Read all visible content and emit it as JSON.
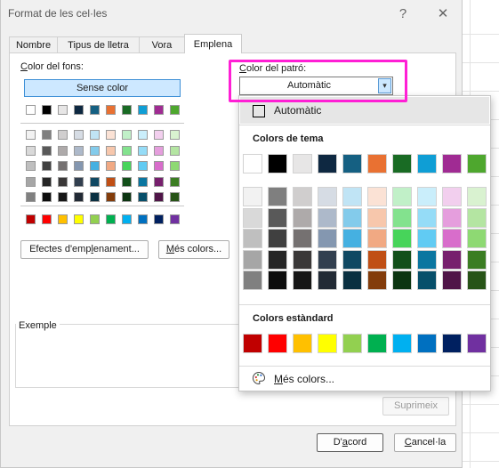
{
  "dialog": {
    "title": "Format de les cel·les",
    "help": "?",
    "close": "✕"
  },
  "tabs": [
    {
      "label": "Nombre"
    },
    {
      "label": "Tipus de lletra"
    },
    {
      "label": "Vora"
    },
    {
      "label": "Emplena"
    }
  ],
  "fill": {
    "bg_color_label": "Color del fons:",
    "no_color_button": "Sense color",
    "pattern_color_label": "Color del patró:",
    "pattern_color_value": "Automàtic",
    "effects_button": "Efectes d'emplenament...",
    "more_colors_button": "Més colors...",
    "sample_label": "Exemple",
    "clear_button": "Suprimeix"
  },
  "footer": {
    "ok_button": "D'acord",
    "cancel_button": "Cancel·la"
  },
  "bg_palette": {
    "top_row": [
      "#ffffff",
      "#000000",
      "#e7e6e6",
      "#0e2841",
      "#156082",
      "#e97132",
      "#196b24",
      "#0f9ed5",
      "#a02b93",
      "#4ea72e"
    ],
    "shade_rows": [
      [
        "#f2f2f2",
        "#7f7f7f",
        "#d0cece",
        "#d6dce4",
        "#c0e4f5",
        "#fbe2d5",
        "#c1f0c8",
        "#caeefb",
        "#f2cfee",
        "#d9f2d0"
      ],
      [
        "#d9d9d9",
        "#595959",
        "#aeaaaa",
        "#adb9ca",
        "#83cbeb",
        "#f7c7ac",
        "#83e28e",
        "#95dcf7",
        "#e59edd",
        "#b4e5a2"
      ],
      [
        "#bfbfbf",
        "#404040",
        "#757171",
        "#8497b0",
        "#45b0e1",
        "#f1a983",
        "#47d45a",
        "#61cbf3",
        "#d86dcb",
        "#8ed973"
      ],
      [
        "#a6a6a6",
        "#262626",
        "#3a3838",
        "#323f4f",
        "#104862",
        "#c04f15",
        "#124f1a",
        "#0b76a0",
        "#77206d",
        "#3b7d23"
      ],
      [
        "#808080",
        "#0d0d0d",
        "#161616",
        "#222a35",
        "#0a3041",
        "#833c0b",
        "#0c3511",
        "#074f6a",
        "#4f1548",
        "#275317"
      ]
    ],
    "standard_row": [
      "#c00000",
      "#ff0000",
      "#ffc000",
      "#ffff00",
      "#92d050",
      "#00b050",
      "#00b0f0",
      "#0070c0",
      "#002060",
      "#7030a0"
    ]
  },
  "dropdown": {
    "auto_label": "Automàtic",
    "auto_swatch": "#000000",
    "theme_header": "Colors de tema",
    "standard_header": "Colors estàndard",
    "more_colors": "Més colors...",
    "palette_icon": "palette-icon"
  },
  "colors": {
    "dialog_bg": "#f0f0f0",
    "selection_blue": "#cde8ff",
    "highlight": "#ff1fd5"
  }
}
